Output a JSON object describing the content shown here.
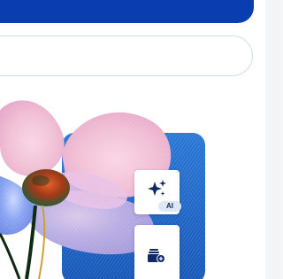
{
  "search": {
    "value": "",
    "placeholder": ""
  },
  "tools": {
    "ai": {
      "icon": "ai-sparkle-icon",
      "badge": "AI"
    },
    "layers": {
      "icon": "add-layer-icon"
    }
  },
  "colors": {
    "top_bar": "#0a3db0",
    "panel_blue": "#1f69c9",
    "icon_navy": "#0e2a66",
    "badge_bg": "#dfe7f6",
    "search_border": "#cfe0f0"
  }
}
